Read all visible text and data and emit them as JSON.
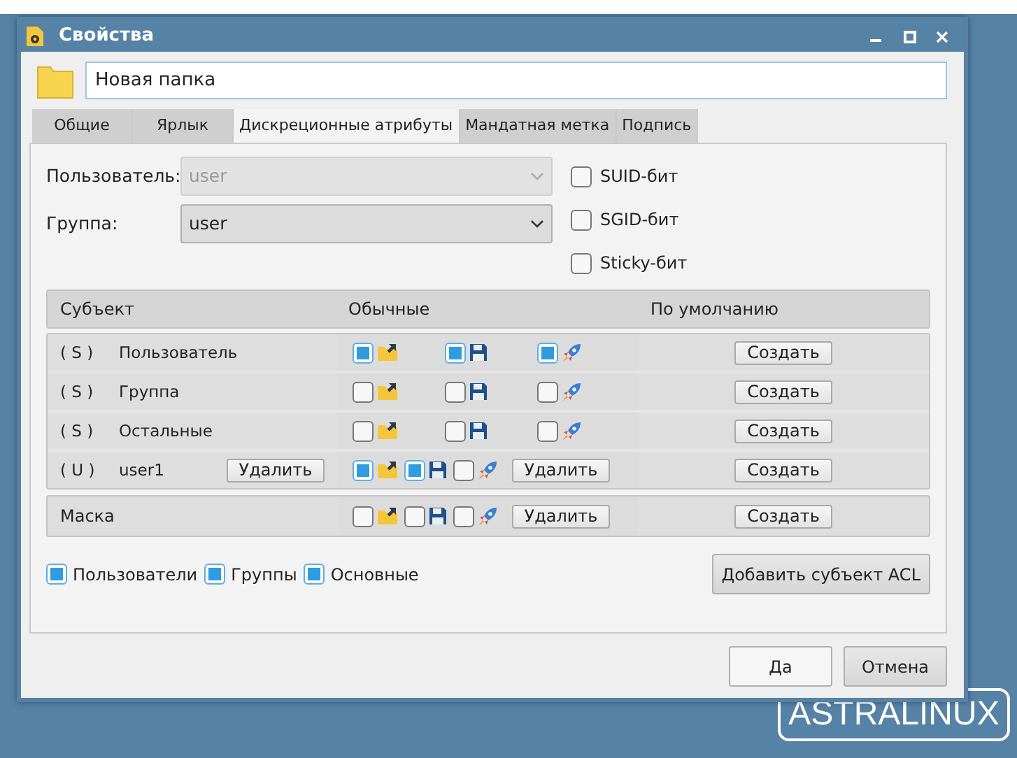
{
  "window": {
    "title": "Свойства"
  },
  "name_field": {
    "value": "Новая папка"
  },
  "tabs": [
    {
      "label": "Общие",
      "selected": false
    },
    {
      "label": "Ярлык",
      "selected": false
    },
    {
      "label": "Дискреционные атрибуты",
      "selected": true
    },
    {
      "label": "Мандатная метка",
      "selected": false
    },
    {
      "label": "Подпись",
      "selected": false
    }
  ],
  "owner": {
    "label": "Пользователь:",
    "value": "user",
    "disabled": true
  },
  "group": {
    "label": "Группа:",
    "value": "user",
    "disabled": false
  },
  "flags": [
    {
      "label": "SUID-бит",
      "checked": false
    },
    {
      "label": "SGID-бит",
      "checked": false
    },
    {
      "label": "Sticky-бит",
      "checked": false
    }
  ],
  "acl_table": {
    "columns": [
      "Субъект",
      "Обычные",
      "По умолчанию"
    ],
    "rows": [
      {
        "type": "( S )",
        "name": "Пользователь",
        "perms": [
          {
            "kind": "read",
            "checked": true
          },
          {
            "kind": "write",
            "checked": true
          },
          {
            "kind": "exec",
            "checked": true
          }
        ],
        "create": "Создать"
      },
      {
        "type": "( S )",
        "name": "Группа",
        "perms": [
          {
            "kind": "read",
            "checked": false
          },
          {
            "kind": "write",
            "checked": false
          },
          {
            "kind": "exec",
            "checked": false
          }
        ],
        "create": "Создать"
      },
      {
        "type": "( S )",
        "name": "Остальные",
        "perms": [
          {
            "kind": "read",
            "checked": false
          },
          {
            "kind": "write",
            "checked": false
          },
          {
            "kind": "exec",
            "checked": false
          }
        ],
        "create": "Создать"
      },
      {
        "type": "( U )",
        "name": "user1",
        "delete": "Удалить",
        "perms": [
          {
            "kind": "read",
            "checked": true
          },
          {
            "kind": "write",
            "checked": true
          },
          {
            "kind": "exec",
            "checked": false
          }
        ],
        "perms_delete": "Удалить",
        "create": "Создать"
      }
    ],
    "mask": {
      "name": "Маска",
      "perms": [
        {
          "kind": "read",
          "checked": false
        },
        {
          "kind": "write",
          "checked": false
        },
        {
          "kind": "exec",
          "checked": false
        }
      ],
      "perms_delete": "Удалить",
      "create": "Создать"
    }
  },
  "filters": [
    {
      "label": "Пользователи",
      "checked": true
    },
    {
      "label": "Группы",
      "checked": true
    },
    {
      "label": "Основные",
      "checked": true
    }
  ],
  "add_button": "Добавить субъект ACL",
  "buttons": [
    "Да",
    "Отмена"
  ],
  "desktop": {
    "logo": "ASTRALINUX"
  }
}
